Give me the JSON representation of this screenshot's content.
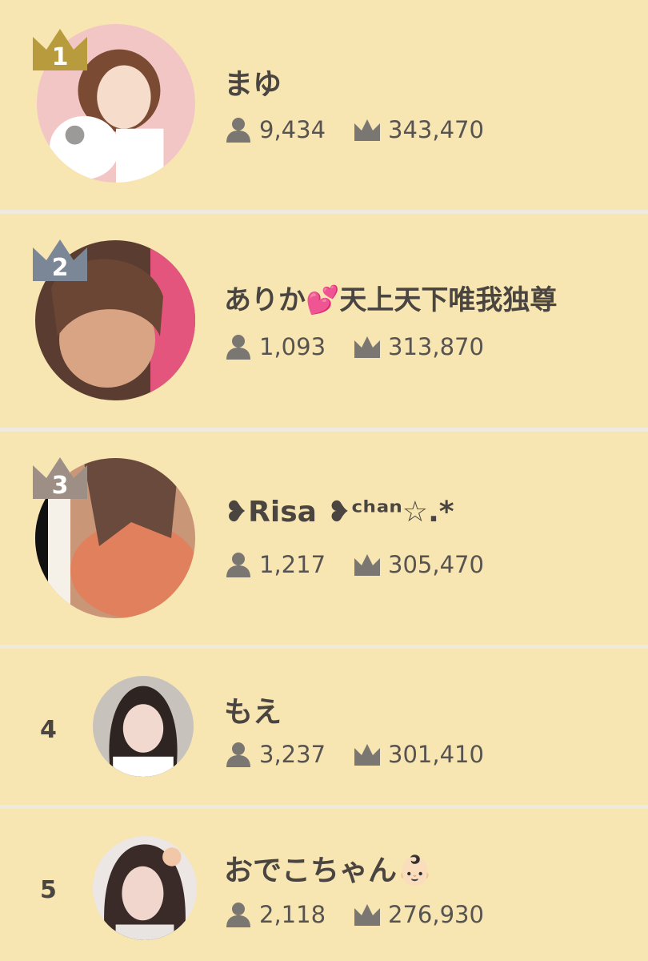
{
  "colors": {
    "background": "#f7e6b1",
    "separator": "#efeadd",
    "text": "#4a4540",
    "icon": "#7a7672",
    "crown_gold": "#b89b3c",
    "crown_silver": "#7b8796",
    "crown_bronze": "#9d8f86"
  },
  "ranking": [
    {
      "rank": "1",
      "name": "まゆ",
      "followers": "9,434",
      "points": "343,470",
      "badge": "gold-crown"
    },
    {
      "rank": "2",
      "name": "ありか💕天上天下唯我独尊",
      "followers": "1,093",
      "points": "313,870",
      "badge": "silver-crown"
    },
    {
      "rank": "3",
      "name": "❥Risa ❥ᶜʰᵃⁿ☆.*",
      "followers": "1,217",
      "points": "305,470",
      "badge": "bronze-crown"
    },
    {
      "rank": "4",
      "name": "もえ",
      "followers": "3,237",
      "points": "301,410",
      "badge": "none"
    },
    {
      "rank": "5",
      "name": "おでこちゃん👶🏻",
      "followers": "2,118",
      "points": "276,930",
      "badge": "none"
    }
  ],
  "icons": {
    "followers": "person-icon",
    "points": "crown-icon"
  }
}
